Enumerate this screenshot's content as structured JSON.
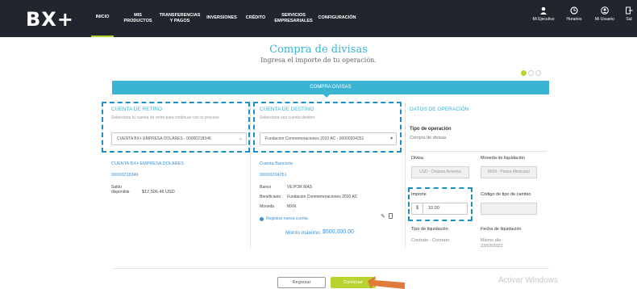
{
  "brand": {
    "logo_text": "BX+"
  },
  "nav": {
    "items": [
      {
        "label": "INICIO"
      },
      {
        "label": "MIS PRODUCTOS"
      },
      {
        "label": "TRANSFERENCIAS\nY PAGOS"
      },
      {
        "label": "INVERSIONES"
      },
      {
        "label": "CRÉDITO"
      },
      {
        "label": "SERVICIOS\nEMPRESARIALES"
      },
      {
        "label": "CONFIGURACIÓN"
      }
    ],
    "utilities": [
      {
        "label": "Mi Ejecutivo",
        "icon": "user-icon"
      },
      {
        "label": "Horarios",
        "icon": "clock-icon"
      },
      {
        "label": "Mi Usuario",
        "icon": "user-circle-icon"
      },
      {
        "label": "Sal",
        "icon": "logout-icon"
      }
    ]
  },
  "page": {
    "title": "Compra de divisas",
    "subtitle": "Ingresa el importe de tu operación.",
    "banner": "COMPRA DIVISAS"
  },
  "steps": {
    "total": 3,
    "active": 1,
    "active_color": "#b8d430",
    "inactive_color": "#cfcfcf"
  },
  "retiro": {
    "title": "CUENTA DE RETIRO",
    "subtitle": "Selecciona tu cuenta de retiro para continuar con tu proceso",
    "selected": "CUENTA BX+ EMPRESA DOLARES - 00000218346",
    "account_name": "CUENTA BX+ EMPRESA DOLARES",
    "account_number": "00000218346",
    "saldo_label": "Saldo\ndisponible",
    "saldo_value": "$17,506.46 USD"
  },
  "destino": {
    "title": "CUENTA DE DESTINO",
    "subtitle": "Selecciona una cuenta destino",
    "selected": "Fundacion Conmemoraciones 2010 AC - 00000204251",
    "account_type": "Cuenta Bancaria",
    "account_number": "00000204251",
    "banco_label": "Banco",
    "banco_value": "VE POR MAS",
    "beneficiario_label": "Beneficiario",
    "beneficiario_value": "Fundacion Conmemoraciones 2010 AC",
    "moneda_label": "Moneda",
    "moneda_value": "MXN",
    "register_link": "Registrar nueva cuenta",
    "monto_label": "Monto máximo:",
    "monto_value": "$500,000.00"
  },
  "operacion": {
    "title": "DATOS DE OPERACIÓN",
    "tipo_label": "Tipo de operación",
    "tipo_value": "Compra de divisas",
    "divisa_label": "Divisa",
    "divisa_value": "USD - Dolares America",
    "moneda_liq_label": "Moneda de liquidación",
    "moneda_liq_value": "MXN - Pesos Mexicano",
    "importe_label": "Importe",
    "importe_prefix": "$",
    "importe_value": "10.00",
    "codigo_label": "Código de tipo de cambio",
    "codigo_value": "",
    "tipo_liq_label": "Tipo de liquidación",
    "tipo_liq_value": "Contrato - Contrato",
    "fecha_label": "Fecha de liquidación",
    "fecha_value": "Mismo día -\n23/03/2022"
  },
  "actions": {
    "back": "Regresar",
    "continue": "Continuar"
  },
  "watermark": "Activar Windows",
  "colors": {
    "accent": "#3bb3d3",
    "lime": "#b8d430",
    "highlight": "#1e8fc2",
    "topbar": "#22252e"
  }
}
